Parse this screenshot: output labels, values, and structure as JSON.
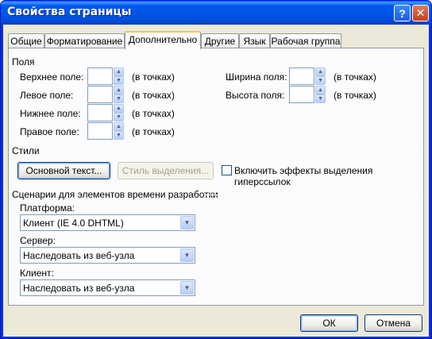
{
  "window": {
    "title": "Свойства страницы",
    "help_glyph": "?",
    "close_glyph": "✕"
  },
  "tabs": [
    {
      "label": "Общие"
    },
    {
      "label": "Форматирование"
    },
    {
      "label": "Дополнительно",
      "active": true
    },
    {
      "label": "Другие"
    },
    {
      "label": "Язык"
    },
    {
      "label": "Рабочая группа"
    }
  ],
  "margins": {
    "section_label": "Поля",
    "top": {
      "label": "Верхнее поле:",
      "value": "",
      "unit": "(в точках)"
    },
    "left": {
      "label": "Левое поле:",
      "value": "",
      "unit": "(в точках)"
    },
    "bottom": {
      "label": "Нижнее поле:",
      "value": "",
      "unit": "(в точках)"
    },
    "right": {
      "label": "Правое поле:",
      "value": "",
      "unit": "(в точках)"
    },
    "width": {
      "label": "Ширина поля:",
      "value": "",
      "unit": "(в точках)"
    },
    "height": {
      "label": "Высота поля:",
      "value": "",
      "unit": "(в точках)"
    }
  },
  "styles": {
    "section_label": "Стили",
    "body_style_button": "Основной текст...",
    "selection_style_button": "Стиль выделения...",
    "hyperlink_effects_label": "Включить эффекты выделения гиперссылок",
    "hyperlink_effects_checked": false
  },
  "scripting": {
    "section_label": "Сценарии для элементов времени разработки",
    "platform_label": "Платформа:",
    "platform_value": "Клиент (IE 4.0 DHTML)",
    "server_label": "Сервер:",
    "server_value": "Наследовать из веб-узла",
    "client_label": "Клиент:",
    "client_value": "Наследовать из веб-узла"
  },
  "footer": {
    "ok": "ОК",
    "cancel": "Отмена"
  },
  "icons": {
    "spin_up": "spin-up-icon",
    "spin_down": "spin-down-icon",
    "dropdown": "chevron-down-icon"
  }
}
